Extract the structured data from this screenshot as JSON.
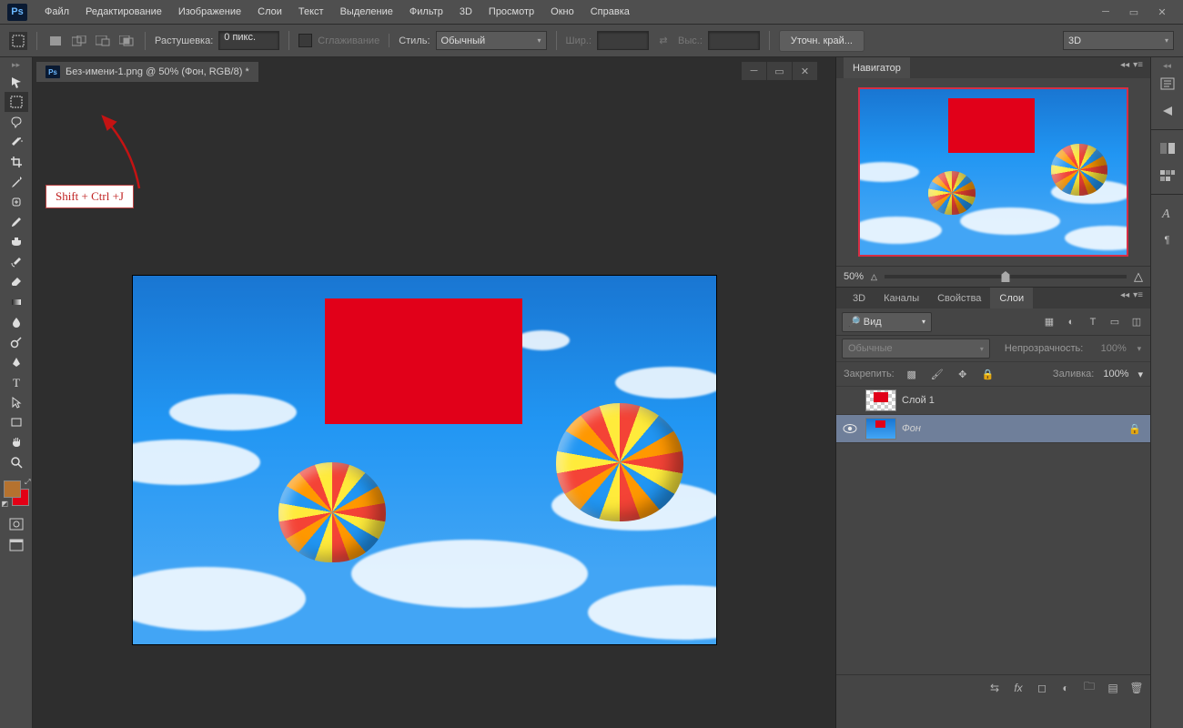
{
  "app": {
    "logo": "Ps"
  },
  "menu": [
    "Файл",
    "Редактирование",
    "Изображение",
    "Слои",
    "Текст",
    "Выделение",
    "Фильтр",
    "3D",
    "Просмотр",
    "Окно",
    "Справка"
  ],
  "options": {
    "feather_label": "Растушевка:",
    "feather_value": "0 пикс.",
    "antialias_label": "Сглаживание",
    "style_label": "Стиль:",
    "style_value": "Обычный",
    "width_label": "Шир.:",
    "height_label": "Выс.:",
    "refine_label": "Уточн. край...",
    "workspace_label": "3D"
  },
  "doc": {
    "title": "Без-имени-1.png @ 50% (Фон, RGB/8) *"
  },
  "navigator": {
    "tab": "Навигатор",
    "zoom": "50%"
  },
  "layers_panel": {
    "tabs": [
      "3D",
      "Каналы",
      "Свойства",
      "Слои"
    ],
    "kind": "Вид",
    "blend": "Обычные",
    "opacity_label": "Непрозрачность:",
    "opacity_value": "100%",
    "lock_label": "Закрепить:",
    "fill_label": "Заливка:",
    "fill_value": "100%",
    "layers": [
      {
        "name": "Слой 1",
        "visible": false,
        "locked": false
      },
      {
        "name": "Фон",
        "visible": true,
        "locked": true
      }
    ]
  },
  "annotation": {
    "text": "Shift + Ctrl +J"
  }
}
